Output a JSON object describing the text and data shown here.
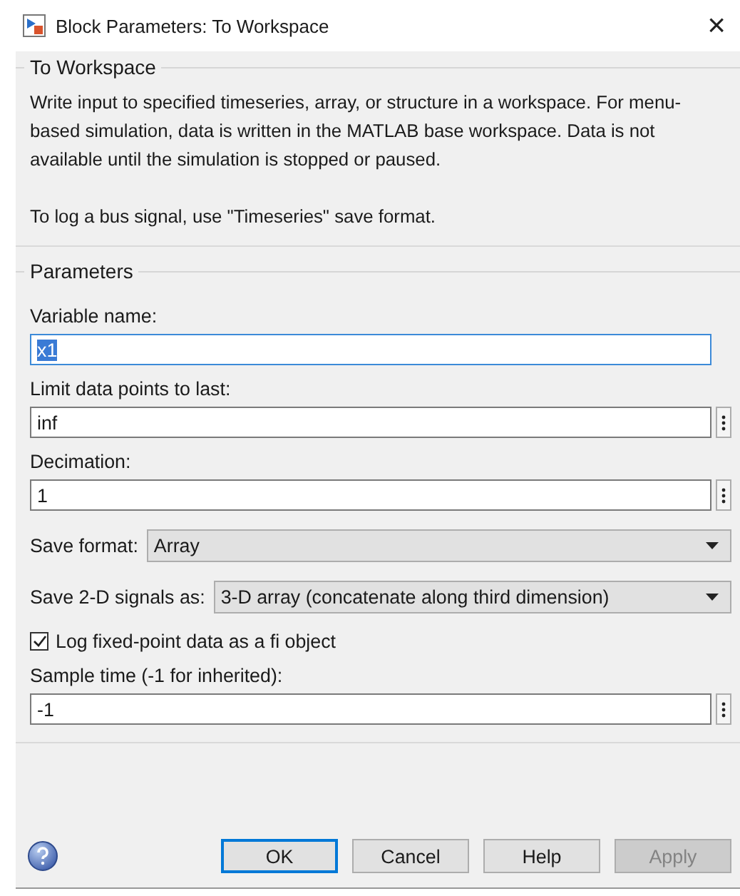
{
  "window": {
    "title": "Block Parameters: To Workspace",
    "close": "×"
  },
  "description_group": {
    "title": "To Workspace",
    "paragraphs": [
      "Write input to specified timeseries, array, or structure in a workspace. For menu-based simulation, data is written in the MATLAB base workspace. Data is not available until the simulation is stopped or paused.",
      "To log a bus signal, use \"Timeseries\" save format."
    ]
  },
  "parameters": {
    "title": "Parameters",
    "fields": [
      {
        "kind": "text",
        "label": "Variable name:",
        "value": "x1",
        "focused": true,
        "has_menu": false
      },
      {
        "kind": "text",
        "label": "Limit data points to last:",
        "value": "inf",
        "focused": false,
        "has_menu": true
      },
      {
        "kind": "text",
        "label": "Decimation:",
        "value": "1",
        "focused": false,
        "has_menu": true
      },
      {
        "kind": "select",
        "label": "Save format:",
        "value": "Array"
      },
      {
        "kind": "select",
        "label": "Save 2-D signals as:",
        "value": "3-D array (concatenate along third dimension)"
      },
      {
        "kind": "checkbox",
        "label": "Log fixed-point data as a fi object",
        "checked": true
      },
      {
        "kind": "text",
        "label": "Sample time (-1 for inherited):",
        "value": "-1",
        "focused": false,
        "has_menu": true
      }
    ]
  },
  "buttons": [
    {
      "label": "OK",
      "default": true,
      "disabled": false
    },
    {
      "label": "Cancel",
      "default": false,
      "disabled": false
    },
    {
      "label": "Help",
      "default": false,
      "disabled": false
    },
    {
      "label": "Apply",
      "default": false,
      "disabled": true
    }
  ]
}
